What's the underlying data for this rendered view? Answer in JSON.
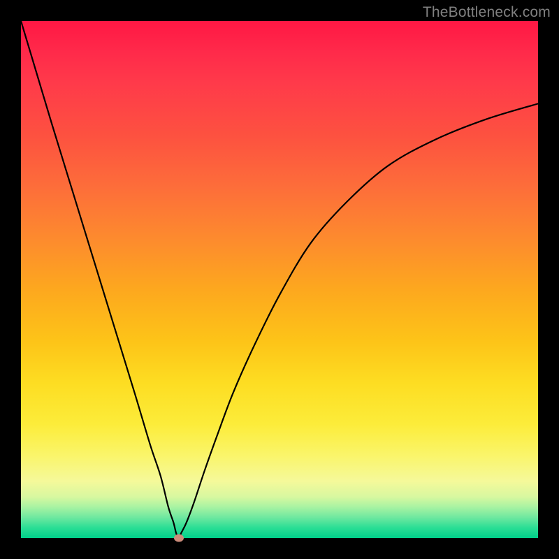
{
  "watermark": "TheBottleneck.com",
  "colors": {
    "frame_border": "#000000",
    "curve": "#000000",
    "marker": "#cc8b7a",
    "gradient_top": "#ff1744",
    "gradient_bottom": "#00d08a"
  },
  "chart_data": {
    "type": "line",
    "title": "",
    "xlabel": "",
    "ylabel": "",
    "xlim": [
      0,
      1
    ],
    "ylim": [
      0,
      1
    ],
    "annotations": [
      "TheBottleneck.com"
    ],
    "marker": {
      "x": 0.305,
      "y": 0.0
    },
    "series": [
      {
        "name": "bottleneck-curve",
        "x": [
          0.0,
          0.03,
          0.06,
          0.1,
          0.14,
          0.18,
          0.22,
          0.25,
          0.27,
          0.285,
          0.295,
          0.3,
          0.305,
          0.31,
          0.32,
          0.335,
          0.355,
          0.38,
          0.41,
          0.45,
          0.5,
          0.56,
          0.63,
          0.71,
          0.8,
          0.9,
          1.0
        ],
        "y": [
          1.0,
          0.9,
          0.8,
          0.67,
          0.54,
          0.41,
          0.28,
          0.18,
          0.12,
          0.06,
          0.03,
          0.01,
          0.0,
          0.01,
          0.03,
          0.07,
          0.13,
          0.2,
          0.28,
          0.37,
          0.47,
          0.57,
          0.65,
          0.72,
          0.77,
          0.81,
          0.84
        ]
      }
    ]
  }
}
